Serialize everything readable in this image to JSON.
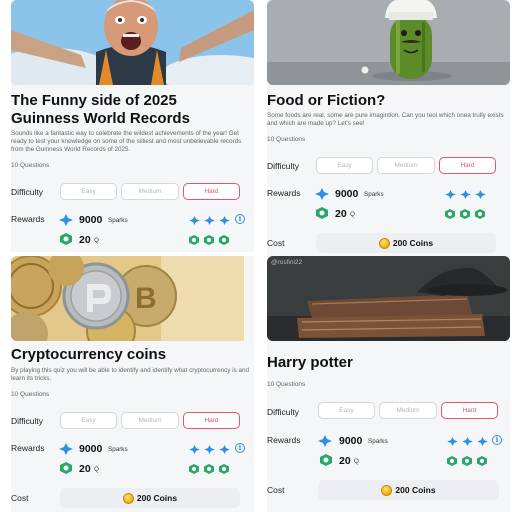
{
  "cards": [
    {
      "title": "The Funny side of 2025 Guinness World Records",
      "title_line1": "The Funny side of 2025",
      "title_line2": "Guinness World Records",
      "description": "Sounds like a fantastic way to celebrate the wildest achievements of the year! Get ready to test your knowledge on some of the silliest and most unbelievable records from the Guinness World Records of 2025.",
      "questions": "10 Questions",
      "difficulty_label": "Difficulty",
      "difficulty_options": [
        "Easy",
        "Medium",
        "Hard"
      ],
      "selected_difficulty": "Hard",
      "rewards_label": "Rewards",
      "sparks_value": "9000",
      "sparks_unit": "Sparks",
      "q_value": "20",
      "q_unit": "Q",
      "image_icon": "excited-skydiver-photo"
    },
    {
      "title": "Food or Fiction?",
      "description": "Some foods are real, some are pure imagintion. Can you teol which onea trully exists and which are made up? Let's see!",
      "questions": "10 Questions",
      "difficulty_label": "Difficulty",
      "difficulty_options": [
        "Easy",
        "Medium",
        "Hard"
      ],
      "selected_difficulty": "Hard",
      "rewards_label": "Rewards",
      "sparks_value": "9000",
      "sparks_unit": "Sparks",
      "q_value": "20",
      "q_unit": "Q",
      "cost_label": "Cost",
      "cost_value": "200 Coins",
      "image_icon": "chef-cucumber-illustration"
    },
    {
      "title": "Cryptocurrency coins",
      "description": "By playing this quiz you will be able to identify and identify what cryptocurrency is and learn its tricks.",
      "questions": "10 Questions",
      "difficulty_label": "Difficulty",
      "difficulty_options": [
        "Easy",
        "Medium",
        "Hard"
      ],
      "selected_difficulty": "Hard",
      "rewards_label": "Rewards",
      "sparks_value": "9000",
      "sparks_unit": "Sparks",
      "q_value": "20",
      "q_unit": "Q",
      "cost_label": "Cost",
      "cost_value": "200 Coins",
      "image_icon": "crypto-coins-photo"
    },
    {
      "title": "Harry potter",
      "watermark": "@rosfini22",
      "questions": "10 Questions",
      "difficulty_label": "Difficulty",
      "difficulty_options": [
        "Easy",
        "Medium",
        "Hard"
      ],
      "selected_difficulty": "Hard",
      "rewards_label": "Rewards",
      "sparks_value": "9000",
      "sparks_unit": "Sparks",
      "q_value": "20",
      "q_unit": "Q",
      "cost_label": "Cost",
      "cost_value": "200 Coins",
      "image_icon": "wizard-hat-books-photo"
    }
  ],
  "colors": {
    "accent": "#e0566a",
    "spark_blue": "#2f8fe0",
    "q_green": "#2aa86a",
    "card_bg": "#f4f6f8",
    "coin_gold": "#f1b21c"
  }
}
